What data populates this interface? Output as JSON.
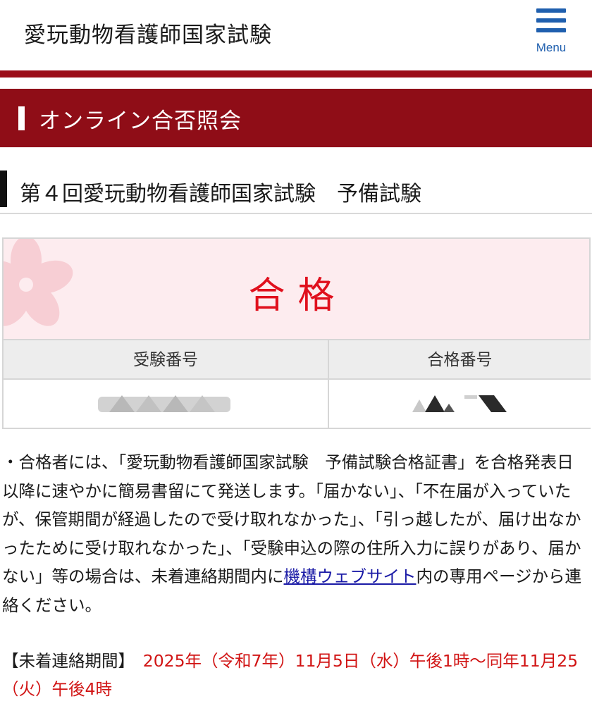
{
  "header": {
    "site_title": "愛玩動物看護師国家試験",
    "menu_label": "Menu",
    "menu_icon": "hamburger-icon"
  },
  "banner": {
    "title": "オンライン合否照会"
  },
  "exam": {
    "title": "第４回愛玩動物看護師国家試験　予備試験"
  },
  "result": {
    "status": "合格",
    "decoration_icon": "sakura-icon"
  },
  "table": {
    "headers": [
      "受験番号",
      "合格番号"
    ]
  },
  "notice": {
    "text_before_link": "・合格者には、「愛玩動物看護師国家試験　予備試験合格証書」を合格発表日以降に速やかに簡易書留にて発送します。「届かない」、「不在届が入っていたが、保管期間が経過したので受け取れなかった」、「引っ越したが、届け出なかったために受け取れなかった」、「受験申込の際の住所入力に誤りがあり、届かない」等の場合は、未着連絡期間内に",
    "link_text": "機構ウェブサイト",
    "text_after_link": "内の専用ページから連絡ください。"
  },
  "period": {
    "label": "【未着連絡期間】",
    "value": "2025年（令和7年）11月5日（水）午後1時～同年11月25（火）午後4時"
  },
  "colors": {
    "brand_red": "#8f0d17",
    "pass_red": "#e0101d",
    "menu_blue": "#1f5fae",
    "period_red": "#d11414",
    "result_bg": "#fdecef"
  }
}
